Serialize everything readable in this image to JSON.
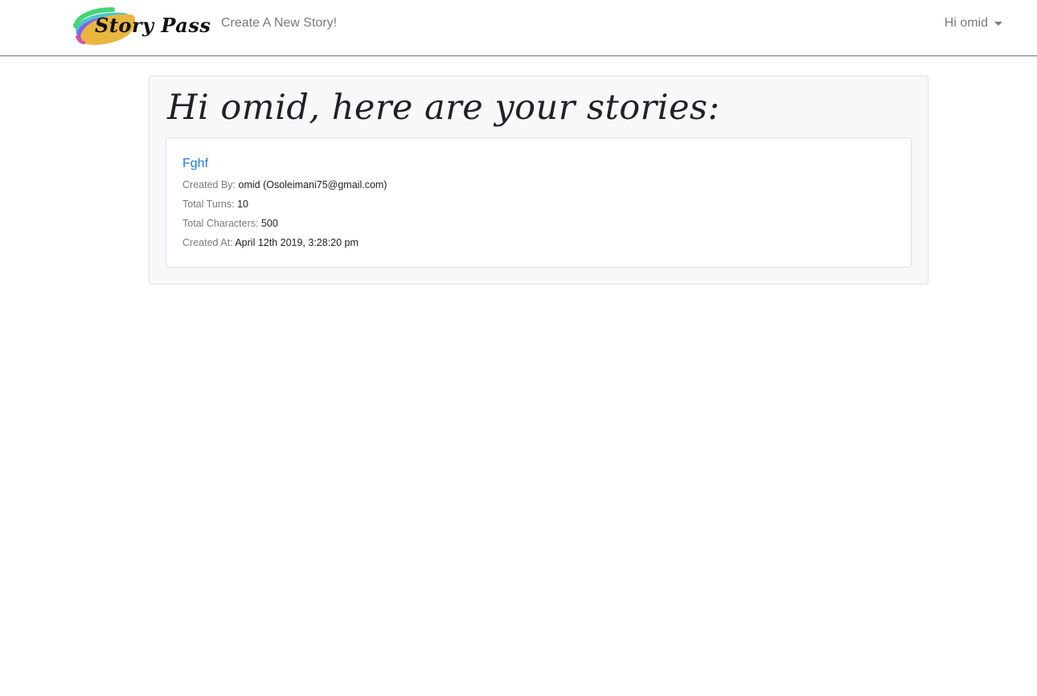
{
  "navbar": {
    "brand_text": "Story Pass",
    "create_link": "Create A New Story!",
    "user_menu": "Hi omid"
  },
  "main": {
    "heading": "Hi omid, here are your stories:",
    "stories": [
      {
        "title": "Fghf",
        "created_by_label": "Created By:",
        "created_by_value": "omid (Osoleimani75@gmail.com)",
        "total_turns_label": "Total Turns:",
        "total_turns_value": "10",
        "total_characters_label": "Total Characters:",
        "total_characters_value": "500",
        "created_at_label": "Created At:",
        "created_at_value": "April 12th 2019, 3:28:20 pm"
      }
    ]
  },
  "colors": {
    "link_blue": "#1f7ae0",
    "muted_gray": "#7a7a7a",
    "panel_bg": "#f7f8f9",
    "logo_yellow": "#e9b640"
  },
  "icons": {
    "brand_logo": "paint-swash-logo-icon",
    "user_menu_caret": "caret-down-icon"
  }
}
